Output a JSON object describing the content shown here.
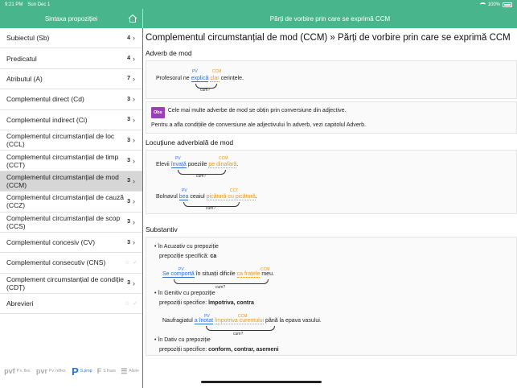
{
  "status": {
    "time": "9:21 PM",
    "date": "Sun Dec 1",
    "battery": "100%"
  },
  "sidebar": {
    "title": "Sintaxa propoziției",
    "items": [
      {
        "label": "Subiectul (Sb)",
        "count": "4",
        "kind": "chevron"
      },
      {
        "label": "Predicatul",
        "count": "4",
        "kind": "chevron"
      },
      {
        "label": "Atributul (A)",
        "count": "7",
        "kind": "chevron"
      },
      {
        "label": "Complementul direct (Cd)",
        "count": "3",
        "kind": "chevron"
      },
      {
        "label": "Complementul indirect (Ci)",
        "count": "3",
        "kind": "chevron"
      },
      {
        "label": "Complementul circumstanțial de loc (CCL)",
        "count": "3",
        "kind": "chevron"
      },
      {
        "label": "Complementul circumstanțial de timp (CCT)",
        "count": "3",
        "kind": "chevron"
      },
      {
        "label": "Complementul circumstanțial de mod (CCM)",
        "count": "3",
        "kind": "chevron",
        "active": true
      },
      {
        "label": "Complementul circumstanțial de cauză (CCZ)",
        "count": "3",
        "kind": "chevron"
      },
      {
        "label": "Complementul circumstanțial de scop (CCS)",
        "count": "3",
        "kind": "chevron"
      },
      {
        "label": "Complementul concesiv (CV)",
        "count": "3",
        "kind": "chevron"
      },
      {
        "label": "Complementul consecutiv (CNS)",
        "count": "",
        "kind": "star"
      },
      {
        "label": "Complement circumstanțial de condiție (CDȚ)",
        "count": "3",
        "kind": "chevron"
      },
      {
        "label": "Abrevieri",
        "count": "",
        "kind": "star"
      }
    ],
    "toolbar": [
      {
        "glyph": "pvf",
        "label": "P.v. flex.",
        "icon": "pvf-icon"
      },
      {
        "glyph": "pvr",
        "label": "Pv. reflex.",
        "icon": "pvr-icon"
      },
      {
        "glyph": "P",
        "label": "S.prop",
        "icon": "prop-icon",
        "active": true
      },
      {
        "glyph": "F",
        "label": "S.fraze",
        "icon": "fraze-icon"
      },
      {
        "glyph": "☰",
        "label": "Altele",
        "icon": "list-icon"
      }
    ]
  },
  "main": {
    "header": "Părți de vorbire prin care se exprimă CCM",
    "page_title": "Complementul circumstanțial de mod (CCM) » Părți de vorbire prin care se exprimă CCM",
    "labels": {
      "pv": "PV",
      "ccm": "CCM",
      "cct": "CCT",
      "q": "cum?"
    },
    "adverb": {
      "title": "Adverb de mod",
      "ex1": {
        "pre": "Profesorul ne ",
        "pv": "explică",
        "mid": " ",
        "ccm": "clar",
        "post": " cerințele."
      }
    },
    "obs": {
      "badge": "Obs",
      "text": "Cele mai multe adverbe de mod se obțin prin conversiune din adjective.",
      "text2": "Pentru a afla condițiile de conversiune ale adjectivului în adverb, vezi capitolul Adverb."
    },
    "locutiune": {
      "title": "Locuțiune adverbială de mod",
      "ex1": {
        "pre": "Elevii ",
        "pv": "învață",
        "mid": " poeziile ",
        "ccm": "pe dinafară",
        "post": "."
      },
      "ex2": {
        "pre": "Bolnavul ",
        "pv": "bea",
        "mid": " ceaiul ",
        "ccm": "picătură cu picătură",
        "post": "."
      }
    },
    "substantiv": {
      "title": "Substantiv",
      "acc": {
        "head": "în Acuzativ cu prepoziție",
        "spec": "prepoziție specifică: ",
        "prep": "ca",
        "ex": {
          "pre": "",
          "pv": "Se comportă",
          "mid": " în situații dificile ",
          "ccm": "ca frațele",
          "post": " meu."
        }
      },
      "gen": {
        "head": "în Genitiv cu prepoziție",
        "spec": "prepoziții specifice: ",
        "prep": "împotriva, contra",
        "ex": {
          "pre": "Naufragiatul ",
          "pv": "a înotat",
          "mid": " ",
          "ccm": "împotriva curentului",
          "post": " până la epava vasului."
        }
      },
      "dat": {
        "head": "în Dativ cu prepoziție",
        "spec": "prepoziții specifice: ",
        "prep": "conform, contrar, asemeni"
      }
    }
  }
}
